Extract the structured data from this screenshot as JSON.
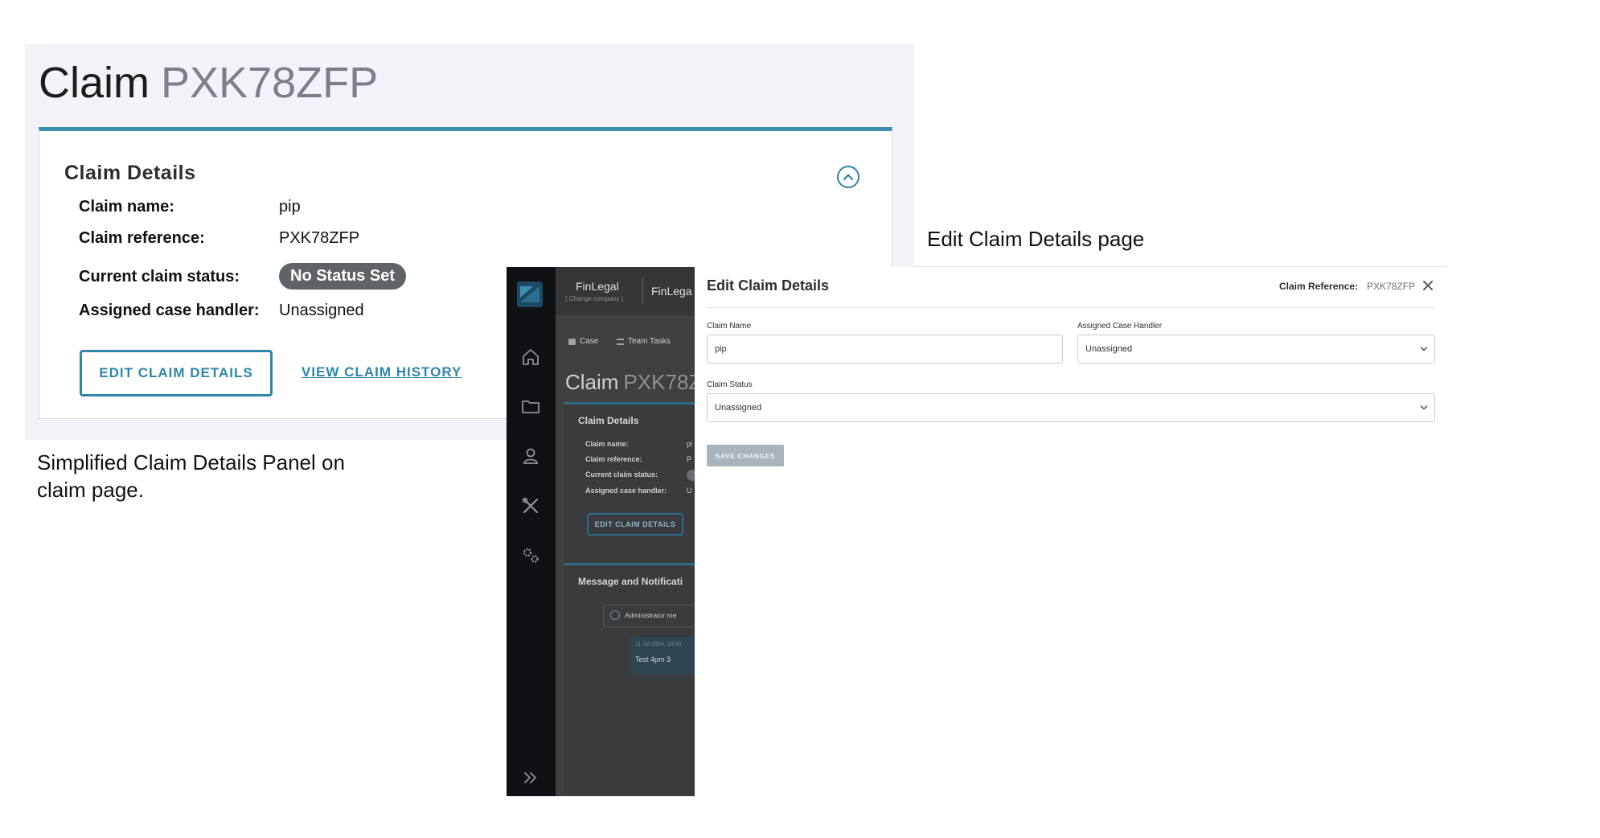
{
  "claim_page": {
    "title_word": "Claim",
    "title_ref": "PXK78ZFP",
    "card": {
      "heading": "Claim Details",
      "rows": [
        {
          "label": "Claim name:",
          "value": "pip"
        },
        {
          "label": "Claim reference:",
          "value": "PXK78ZFP"
        },
        {
          "label": "Current claim status:",
          "value": "No Status Set"
        },
        {
          "label": "Assigned case handler:",
          "value": "Unassigned"
        }
      ],
      "edit_button": "EDIT CLAIM DETAILS",
      "history_link": "VIEW CLAIM HISTORY"
    },
    "caption": "Simplified Claim Details Panel on claim page."
  },
  "edit_page": {
    "caption": "Edit Claim Details page",
    "background": {
      "brand": "FinLegal",
      "brand_sub": "( Change company )",
      "brand_2": "FinLega",
      "tabs": [
        "Case",
        "Team Tasks"
      ],
      "title_word": "Claim",
      "title_ref": "PXK78Z",
      "card_heading": "Claim Details",
      "rows": [
        "Claim name:",
        "Claim reference:",
        "Current claim status:",
        "Assigned case handler:"
      ],
      "row_values": [
        "pi",
        "P",
        "",
        "U"
      ],
      "edit_button": "EDIT CLAIM DETAILS",
      "card2_heading": "Message and Notificati",
      "radio_label": "Administrator me",
      "message_date": "11 Jul 2024, 00:00",
      "message_text": "Test 4pm 3"
    },
    "modal": {
      "title": "Edit Claim Details",
      "ref_label": "Claim Reference:",
      "ref_value": "PXK78ZFP",
      "claim_name_label": "Claim Name",
      "claim_name_value": "pip",
      "handler_label": "Assigned Case Handler",
      "handler_value": "Unassigned",
      "status_label": "Claim Status",
      "status_value": "Unassigned",
      "save_button": "SAVE CHANGES"
    }
  },
  "colors": {
    "accent": "#2f86a8",
    "status_pill": "#5f6368",
    "panel_bg": "#f1f3f8",
    "sidebar": "#0f1114"
  },
  "icons": [
    "chevron-up-icon",
    "close-icon",
    "chevron-down-icon",
    "home-icon",
    "folder-icon",
    "user-icon",
    "tools-icon",
    "gears-icon",
    "double-chevron-right-icon",
    "briefcase-icon",
    "list-icon"
  ]
}
